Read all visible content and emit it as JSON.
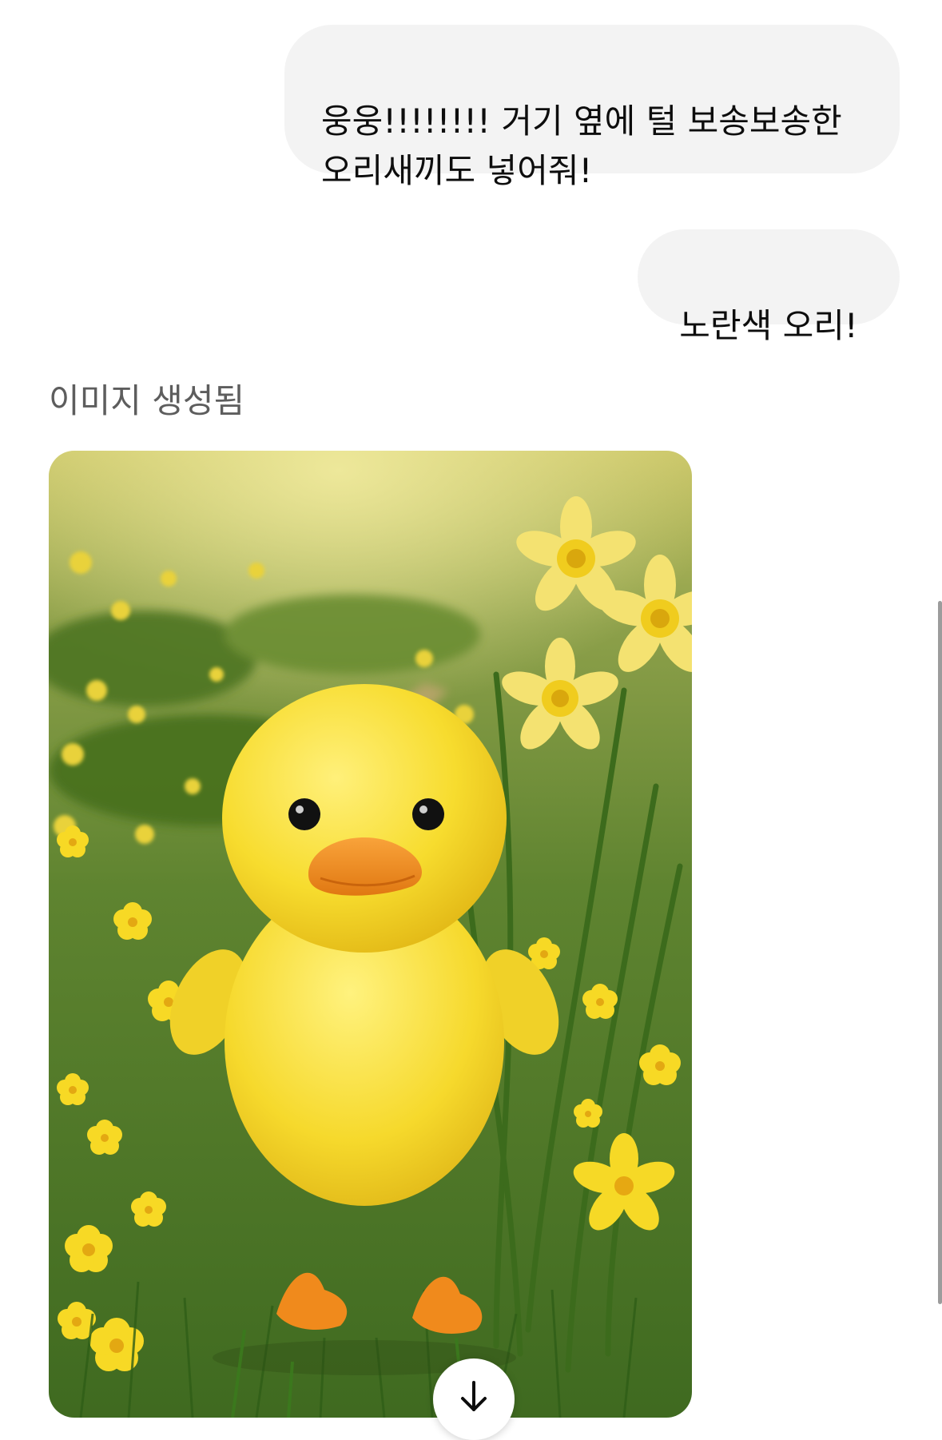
{
  "conversation": {
    "messages": [
      {
        "role": "user",
        "text": "웅웅!!!!!!!! 거기 옆에 털 보송보송한\n오리새끼도 넣어줘!"
      },
      {
        "role": "user",
        "text": "노란색 오리!"
      }
    ],
    "assistant_status": "이미지 생성됨",
    "generated_image": {
      "icon": "felt-yellow-duckling-in-daffodil-meadow"
    }
  },
  "controls": {
    "scroll_down_icon": "arrow-down-icon"
  },
  "colors": {
    "bubble_bg": "#f3f3f3",
    "text": "#0d0d0d",
    "status_text": "#5d5d5d",
    "scrollbar": "#9c9c9c",
    "duck_yellow": "#f5d92a",
    "beak_orange": "#f08a1c",
    "grass_green": "#4f7a23"
  }
}
